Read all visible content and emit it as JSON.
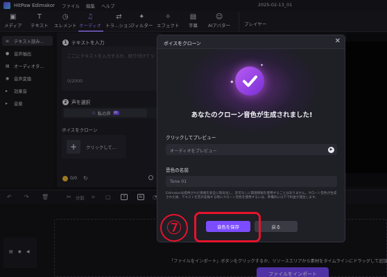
{
  "app": {
    "name": "HitPaw Edimakor",
    "window_title": "2025-02-13_01"
  },
  "menu": [
    "ファイル",
    "編集",
    "ヘルプ"
  ],
  "toolbar": {
    "tools": [
      {
        "icon": "media-icon",
        "label": "メディア"
      },
      {
        "icon": "text-icon",
        "label": "テキスト"
      },
      {
        "icon": "element-icon",
        "label": "エレメント"
      },
      {
        "icon": "audio-icon",
        "label": "オーディオ",
        "active": true
      },
      {
        "icon": "transition-icon",
        "label": "トラ…ション"
      },
      {
        "icon": "filter-icon",
        "label": "フィルター"
      },
      {
        "icon": "effect-icon",
        "label": "エフェクト"
      },
      {
        "icon": "subtitle-icon",
        "label": "字幕"
      },
      {
        "icon": "ai-avatar-icon",
        "label": "AIアバター"
      }
    ],
    "player_label": "プレイヤー"
  },
  "sidebar": {
    "items": [
      {
        "label": "テキスト読み…",
        "active": true
      },
      {
        "label": "音声抽出"
      },
      {
        "label": "オーディオタ…"
      },
      {
        "label": "音声変換"
      },
      {
        "label": "効果音"
      },
      {
        "label": "音楽"
      }
    ]
  },
  "panel": {
    "step1_num": "1",
    "step1_title": "テキストを入力",
    "textbox_placeholder": "ここにテキストを入力するか、貼り付けてリ",
    "textbox_count": "0/2000",
    "step2_num": "2",
    "step2_title": "声を選択",
    "voice_tab_label": "私の声",
    "voice_tab_badge": "AI",
    "clone_section_label": "ボイスをクローン",
    "clone_button_label": "クリックして…",
    "credit_value": "0/0"
  },
  "modal": {
    "title": "ボイスをクローン",
    "close_glyph": "✕",
    "success_title": "あなたのクローン音色が生成されました!",
    "preview_label": "クリックしてプレビュー",
    "preview_placeholder": "オーディオをプレビュー",
    "name_label": "音色の名前",
    "name_value": "Tone 01",
    "disclaimer": "Edimakorは提供された情報を安全に暗号化し、許可なしに関連情報を使用することはありません。クローン音色が生成された後、テキストを音声変換する際にクローン音色を使用するには、準備的に以下で料金が発生します。",
    "save_label": "音色を保存",
    "back_label": "戻る"
  },
  "timeline": {
    "split_label": "分割",
    "import_hint": "「ファイルをインポート」ボタンをクリックするか、リソースエリアから素材をタイムラインにドラッグして追加",
    "import_button": "ファイルをインポート"
  },
  "annotation": {
    "step_marker": "⑦",
    "highlight_color": "#e8132b"
  },
  "colors": {
    "accent": "#7b4dff",
    "annotation": "#e8132b"
  }
}
